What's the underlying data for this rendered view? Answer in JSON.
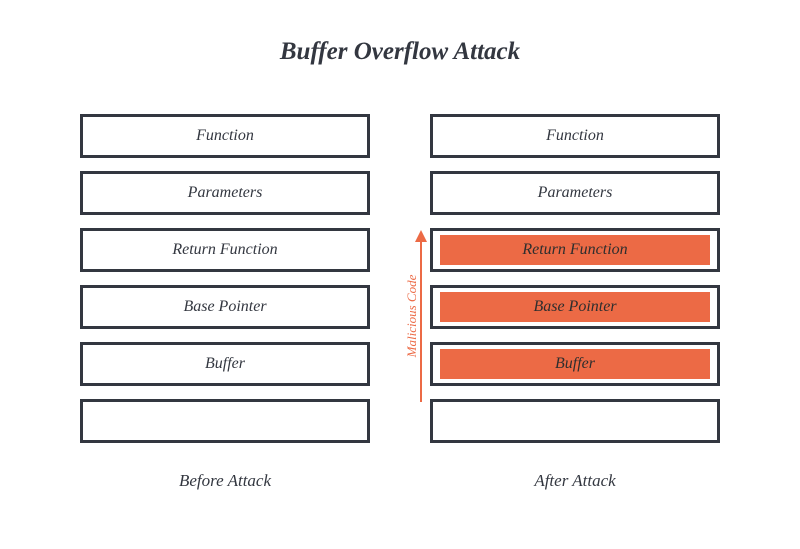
{
  "title": "Buffer Overflow Attack",
  "colors": {
    "border": "#333740",
    "highlight": "#ec6a45"
  },
  "arrow_label": "Malicious Code",
  "before": {
    "caption": "Before Attack",
    "boxes": [
      {
        "label": "Function",
        "highlight": false
      },
      {
        "label": "Parameters",
        "highlight": false
      },
      {
        "label": "Return Function",
        "highlight": false
      },
      {
        "label": "Base Pointer",
        "highlight": false
      },
      {
        "label": "Buffer",
        "highlight": false
      },
      {
        "label": "",
        "highlight": false
      }
    ]
  },
  "after": {
    "caption": "After Attack",
    "boxes": [
      {
        "label": "Function",
        "highlight": false
      },
      {
        "label": "Parameters",
        "highlight": false
      },
      {
        "label": "Return Function",
        "highlight": true
      },
      {
        "label": "Base Pointer",
        "highlight": true
      },
      {
        "label": "Buffer",
        "highlight": true
      },
      {
        "label": "",
        "highlight": false
      }
    ]
  }
}
